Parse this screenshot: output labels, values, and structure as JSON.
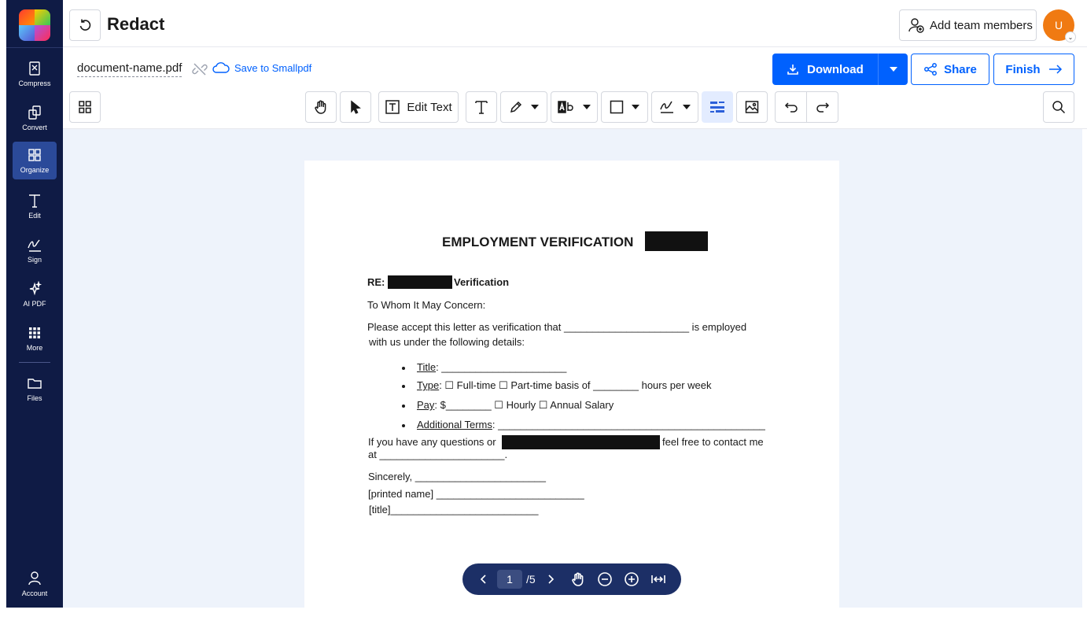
{
  "app": {
    "title": "Redact"
  },
  "sidebar": {
    "items": [
      {
        "label": "Compress",
        "icon": "compress-icon"
      },
      {
        "label": "Convert",
        "icon": "convert-icon"
      },
      {
        "label": "Organize",
        "icon": "organize-icon",
        "active": true
      },
      {
        "label": "Edit",
        "icon": "edit-text-icon"
      },
      {
        "label": "Sign",
        "icon": "signature-icon"
      },
      {
        "label": "AI PDF",
        "icon": "sparkle-icon"
      },
      {
        "label": "More",
        "icon": "grid-dots-icon"
      },
      {
        "label": "Files",
        "icon": "folder-icon"
      }
    ],
    "account": {
      "label": "Account",
      "icon": "user-icon"
    }
  },
  "header": {
    "team_button": "Add team members",
    "avatar_initial": "U"
  },
  "document": {
    "name": "document-name.pdf",
    "save_link": "Save to Smallpdf"
  },
  "actions": {
    "download": "Download",
    "share": "Share",
    "finish": "Finish"
  },
  "toolbar": {
    "edit_text": "Edit Text"
  },
  "page": {
    "title": "EMPLOYMENT VERIFICATION",
    "re_label": "RE:",
    "re_suffix": "Verification",
    "greeting": "To Whom It May Concern:",
    "para1_line1": "Please accept this letter as verification that ______________________ is employed",
    "para1_line2": "with us under the following details:",
    "title_label": "Title",
    "title_rest": ": ______________________",
    "type_label": "Type",
    "type_rest": ": ☐ Full-time ☐ Part-time basis of ________ hours per week",
    "pay_label": "Pay",
    "pay_rest": ": $________ ☐ Hourly ☐ Annual Salary",
    "terms_label": "Additional Terms",
    "terms_rest": ": _______________________________________________",
    "questions_pre": "If you have any questions or",
    "questions_post": "feel free to contact me",
    "questions_line2": "at ______________________.",
    "sincerely": "Sincerely, _______________________",
    "printed_name": "[printed name] __________________________",
    "title_line": "[title]__________________________"
  },
  "pager": {
    "current_page": "1",
    "total": "/5"
  },
  "colors": {
    "sidebar_bg": "#0f1b45",
    "accent": "#0061fe",
    "canvas_bg": "#eef3fb",
    "avatar": "#f07a12"
  }
}
